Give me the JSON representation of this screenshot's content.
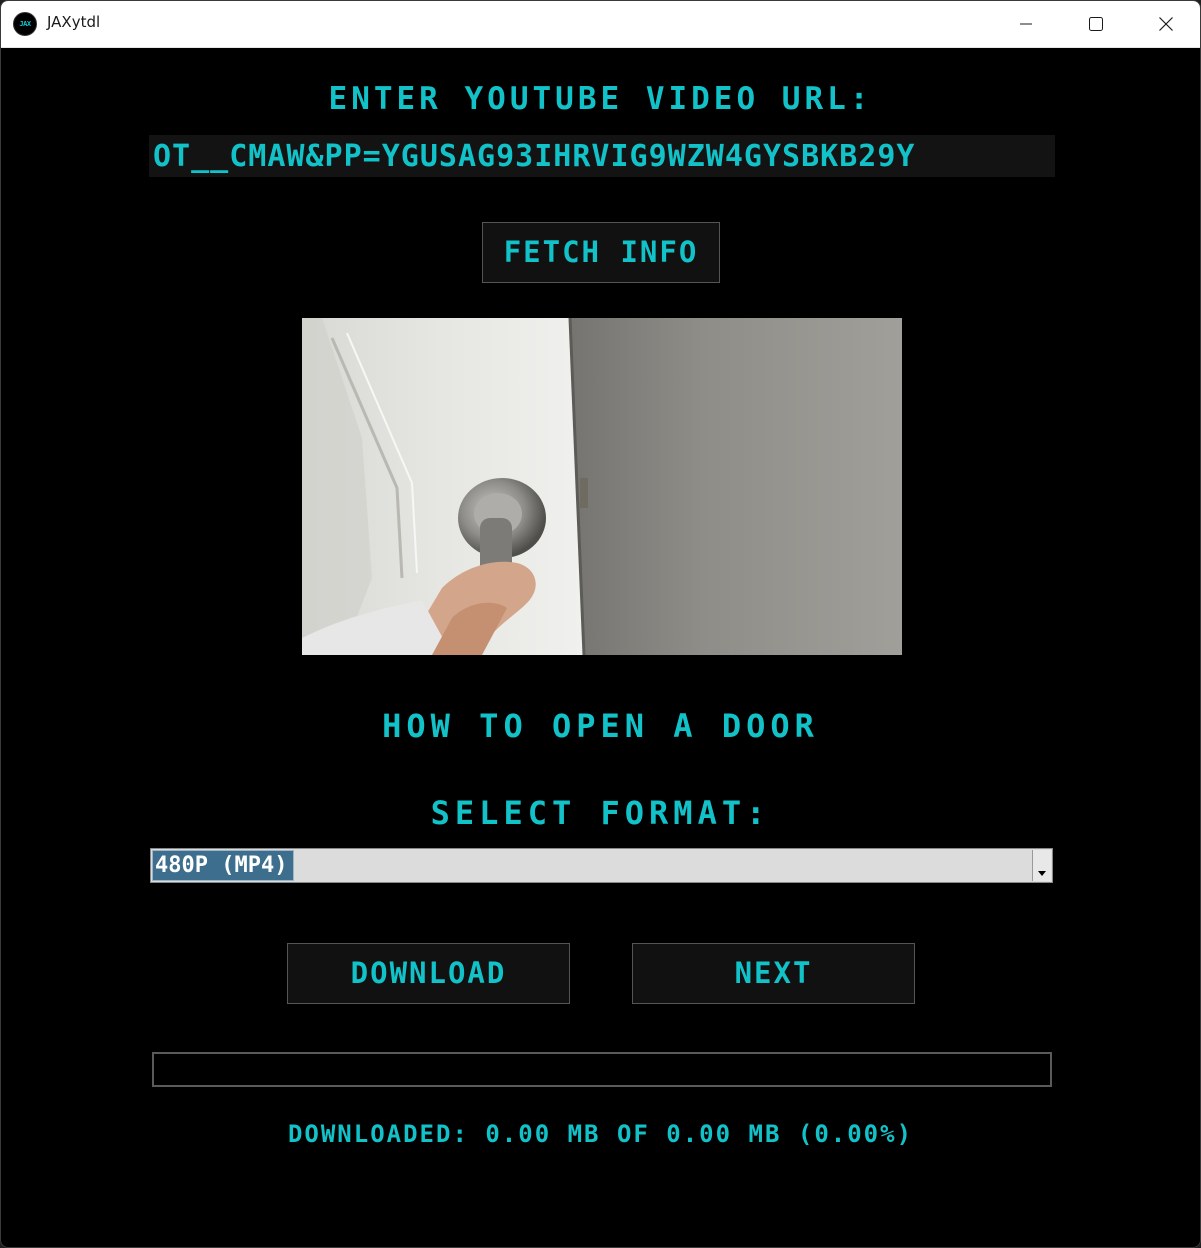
{
  "window": {
    "title": "JAXytdl",
    "icon_text": "JAX",
    "icon": "jax-app-icon"
  },
  "controls": {
    "minimize_icon": "minimize-icon",
    "maximize_icon": "maximize-icon",
    "close_icon": "close-icon"
  },
  "url_section": {
    "label": "Enter YouTube Video URL:",
    "value": "ot__cmAw&pp=ygUSaG93IHRvIG9wZW4gYSBkb29y"
  },
  "fetch_button": {
    "label": "Fetch Info"
  },
  "video": {
    "thumbnail": "door-knob-thumbnail",
    "title": "How to Open a Door"
  },
  "format_section": {
    "label": "Select Format:",
    "selected": "480p (mp4)"
  },
  "actions": {
    "download_label": "Download",
    "next_label": "Next"
  },
  "progress": {
    "fraction": 0.0,
    "status_text": "Downloaded: 0.00 MB of 0.00 MB (0.00%)"
  },
  "colors": {
    "accent": "#12c2c9",
    "background": "#000000",
    "button_bg": "#111111",
    "selection": "#3d6e8e"
  }
}
